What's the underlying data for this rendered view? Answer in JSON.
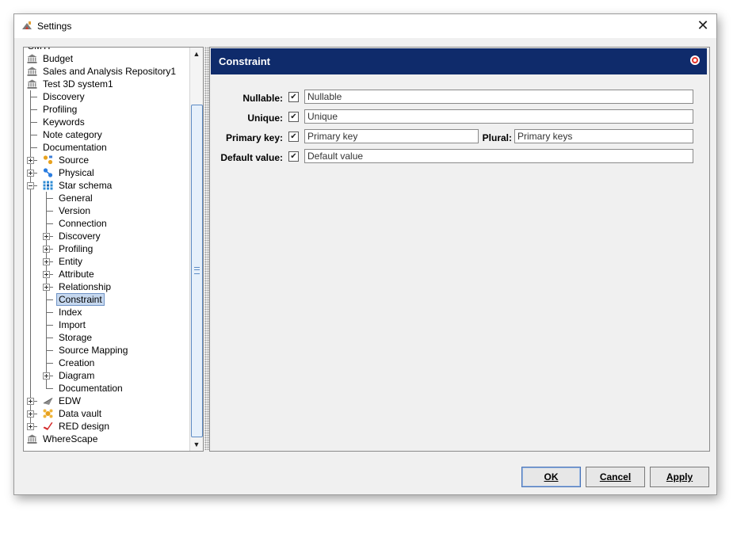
{
  "window": {
    "title": "Settings",
    "close_glyph": "✕"
  },
  "tree": {
    "items": [
      {
        "label": "SMTP",
        "depth": 0,
        "icon": "none"
      },
      {
        "label": "Budget",
        "depth": 0,
        "icon": "bank-icon"
      },
      {
        "label": "Sales and Analysis Repository1",
        "depth": 0,
        "icon": "bank-icon"
      },
      {
        "label": "Test 3D system1",
        "depth": 0,
        "icon": "bank-icon"
      },
      {
        "label": "Discovery",
        "depth": 1,
        "expander": "none",
        "icon": "none"
      },
      {
        "label": "Profiling",
        "depth": 1,
        "expander": "none",
        "icon": "none"
      },
      {
        "label": "Keywords",
        "depth": 1,
        "expander": "none",
        "icon": "none"
      },
      {
        "label": "Note category",
        "depth": 1,
        "expander": "none",
        "icon": "none"
      },
      {
        "label": "Documentation",
        "depth": 1,
        "expander": "none",
        "icon": "none"
      },
      {
        "label": "Source",
        "depth": 1,
        "expander": "plus",
        "icon": "source-icon"
      },
      {
        "label": "Physical",
        "depth": 1,
        "expander": "plus",
        "icon": "physical-icon"
      },
      {
        "label": "Star schema",
        "depth": 1,
        "expander": "minus",
        "icon": "star-schema-icon"
      },
      {
        "label": "General",
        "depth": 2,
        "expander": "none",
        "icon": "none"
      },
      {
        "label": "Version",
        "depth": 2,
        "expander": "none",
        "icon": "none"
      },
      {
        "label": "Connection",
        "depth": 2,
        "expander": "none",
        "icon": "none"
      },
      {
        "label": "Discovery",
        "depth": 2,
        "expander": "plus",
        "icon": "none"
      },
      {
        "label": "Profiling",
        "depth": 2,
        "expander": "plus",
        "icon": "none"
      },
      {
        "label": "Entity",
        "depth": 2,
        "expander": "plus",
        "icon": "none"
      },
      {
        "label": "Attribute",
        "depth": 2,
        "expander": "plus",
        "icon": "none"
      },
      {
        "label": "Relationship",
        "depth": 2,
        "expander": "plus",
        "icon": "none"
      },
      {
        "label": "Constraint",
        "depth": 2,
        "expander": "none",
        "icon": "none",
        "selected": true
      },
      {
        "label": "Index",
        "depth": 2,
        "expander": "none",
        "icon": "none"
      },
      {
        "label": "Import",
        "depth": 2,
        "expander": "none",
        "icon": "none"
      },
      {
        "label": "Storage",
        "depth": 2,
        "expander": "none",
        "icon": "none"
      },
      {
        "label": "Source Mapping",
        "depth": 2,
        "expander": "none",
        "icon": "none"
      },
      {
        "label": "Creation",
        "depth": 2,
        "expander": "none",
        "icon": "none"
      },
      {
        "label": "Diagram",
        "depth": 2,
        "expander": "plus",
        "icon": "none"
      },
      {
        "label": "Documentation",
        "depth": 2,
        "expander": "none",
        "icon": "none",
        "last": true
      },
      {
        "label": "EDW",
        "depth": 1,
        "expander": "plus",
        "icon": "edw-icon"
      },
      {
        "label": "Data vault",
        "depth": 1,
        "expander": "plus",
        "icon": "data-vault-icon"
      },
      {
        "label": "RED design",
        "depth": 1,
        "expander": "plus",
        "icon": "red-design-icon",
        "last": true
      },
      {
        "label": "WhereScape",
        "depth": 0,
        "icon": "bank-icon"
      }
    ]
  },
  "content": {
    "title": "Constraint",
    "fields": {
      "nullable": {
        "label": "Nullable:",
        "checked": true,
        "value": "Nullable"
      },
      "unique": {
        "label": "Unique:",
        "checked": true,
        "value": "Unique"
      },
      "primary_key": {
        "label": "Primary key:",
        "checked": true,
        "value": "Primary key"
      },
      "plural": {
        "label": "Plural:",
        "value": "Primary keys"
      },
      "default_value": {
        "label": "Default value:",
        "checked": true,
        "value": "Default value"
      }
    }
  },
  "buttons": {
    "ok": "OK",
    "cancel": "Cancel",
    "apply": "Apply"
  },
  "colors": {
    "header_bg": "#0f2b6b",
    "selection_bg": "#c6d8ef",
    "window_bg": "#f0f0f0"
  }
}
